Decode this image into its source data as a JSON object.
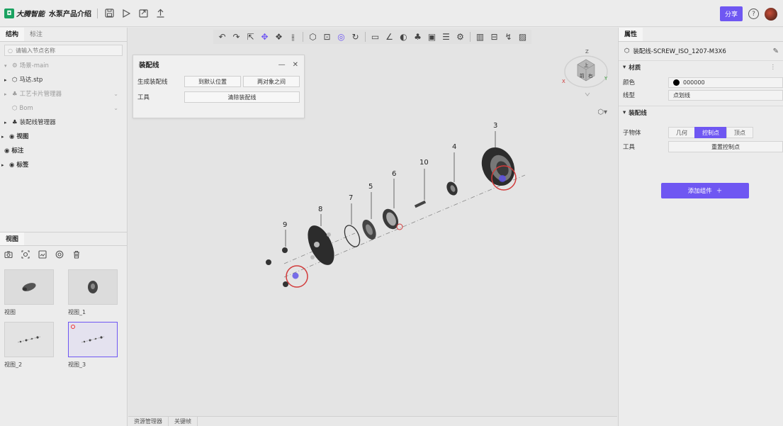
{
  "app": {
    "logo_mark": "◘",
    "logo_text": "大腾智能",
    "title": "水泵产品介绍",
    "share_label": "分享",
    "help_label": "?"
  },
  "left_panel": {
    "tabs": [
      "结构",
      "标注"
    ],
    "search_placeholder": "请输入节点名称",
    "tree": [
      {
        "label": "场景-main",
        "caret": "▾",
        "style": "dim"
      },
      {
        "label": "马达.stp",
        "caret": "▸",
        "style": "normal"
      },
      {
        "label": "工艺卡片管理器",
        "caret": "▸",
        "style": "dim",
        "end": "⌄"
      },
      {
        "label": "Bom",
        "caret": "",
        "style": "dim",
        "end": "⌄"
      },
      {
        "label": "装配线管理器",
        "caret": "▸",
        "style": "normal"
      },
      {
        "label": "视图",
        "caret": "▸",
        "style": "bold"
      },
      {
        "label": "标注",
        "caret": "",
        "style": "bold"
      },
      {
        "label": "标签",
        "caret": "▸",
        "style": "bold"
      }
    ],
    "view_tab": "视图",
    "views": [
      "视图",
      "视图_1",
      "视图_2",
      "视图_3"
    ]
  },
  "dialog": {
    "title": "装配线",
    "minimize": "—",
    "close": "✕",
    "row1_label": "生成装配线",
    "btn_default": "到默认位置",
    "btn_between": "两对象之间",
    "row2_label": "工具",
    "btn_clear": "清除装配线"
  },
  "viewport": {
    "bottom_tabs": [
      "资源管理器",
      "关键帧"
    ],
    "callouts": [
      "3",
      "4",
      "10",
      "6",
      "5",
      "7",
      "8",
      "9"
    ],
    "cube_labels": {
      "top": "Z",
      "left": "X",
      "right": "Y",
      "face_front": "前",
      "face_right": "右",
      "face_top": "上"
    }
  },
  "right_panel": {
    "tab": "属性",
    "object_name": "装配线-SCREW_ISO_1207-M3X6",
    "section_material": "材质",
    "color_label": "颜色",
    "color_value": "000000",
    "linetype_label": "线型",
    "linetype_value": "点划线",
    "section_assembly": "装配线",
    "child_label": "子物体",
    "child_options": [
      "几何",
      "控制点",
      "顶点"
    ],
    "child_selected": "控制点",
    "tool_label": "工具",
    "reset_label": "重置控制点",
    "add_label": "添加组件",
    "accent_color": "#6f57f2"
  }
}
